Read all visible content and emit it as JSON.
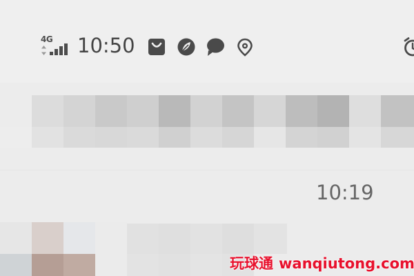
{
  "status_bar": {
    "network_type": "4G",
    "signal_bars": 4,
    "time": "10:50",
    "notification_icons": [
      "shopping-bag-icon",
      "leaf-icon",
      "chat-bubble-icon",
      "location-pin-icon"
    ],
    "alarm_icon": "alarm-clock-icon"
  },
  "message_list": {
    "item_timestamp": "10:19"
  },
  "watermark": {
    "chinese": "玩球通",
    "latin": "wanqiutong.com",
    "color": "#e8112d"
  }
}
